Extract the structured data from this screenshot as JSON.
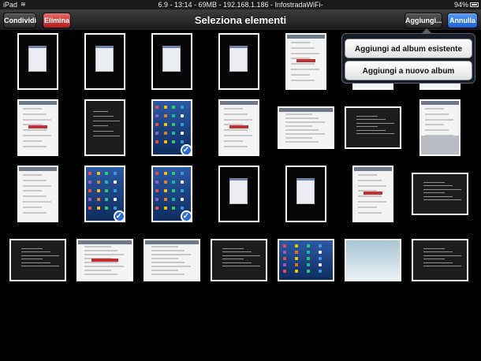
{
  "status_bar": {
    "device": "iPad",
    "center_text": "6.9 - 13:14 - 69MB - 192.168.1.186 - InfostradaWiFi-",
    "battery": "94%"
  },
  "nav": {
    "share_label": "Condividi",
    "delete_label": "Elimina",
    "title": "Seleziona elementi",
    "add_label": "Aggiungi...",
    "cancel_label": "Annulla"
  },
  "popover": {
    "items": [
      "Aggiungi ad album esistente",
      "Aggiungi a nuovo album"
    ]
  },
  "colors": {
    "accent_blue": "#2a6bd6",
    "delete_red": "#c0392b",
    "background": "#000000"
  },
  "thumbnails": [
    {
      "kind": "portrait-black",
      "selected": false
    },
    {
      "kind": "portrait-black",
      "selected": false
    },
    {
      "kind": "portrait-black",
      "selected": false
    },
    {
      "kind": "portrait-black",
      "selected": false
    },
    {
      "kind": "portrait-settings",
      "selected": false
    },
    {
      "kind": "portrait-doc",
      "selected": false
    },
    {
      "kind": "portrait-doc",
      "selected": false
    },
    {
      "kind": "portrait-doc",
      "selected": false
    },
    {
      "kind": "portrait-dark",
      "selected": false
    },
    {
      "kind": "portrait-homescreen",
      "selected": true
    },
    {
      "kind": "portrait-settings",
      "selected": false
    },
    {
      "kind": "landscape-doc",
      "selected": false
    },
    {
      "kind": "landscape-dark",
      "selected": false
    },
    {
      "kind": "portrait-keyboard",
      "selected": false
    },
    {
      "kind": "portrait-doc",
      "selected": false
    },
    {
      "kind": "portrait-homescreen",
      "selected": true
    },
    {
      "kind": "portrait-homescreen",
      "selected": true
    },
    {
      "kind": "portrait-black",
      "selected": false
    },
    {
      "kind": "portrait-black",
      "selected": false
    },
    {
      "kind": "portrait-doc",
      "selected": false
    },
    {
      "kind": "landscape-dark",
      "selected": false
    },
    {
      "kind": "landscape-dark",
      "selected": false
    },
    {
      "kind": "landscape-doc",
      "selected": false
    },
    {
      "kind": "landscape-doc",
      "selected": false
    },
    {
      "kind": "landscape-dark",
      "selected": false
    },
    {
      "kind": "landscape-homescreen",
      "selected": false
    },
    {
      "kind": "landscape-wallpaper",
      "selected": false
    },
    {
      "kind": "landscape-dark",
      "selected": false
    }
  ]
}
